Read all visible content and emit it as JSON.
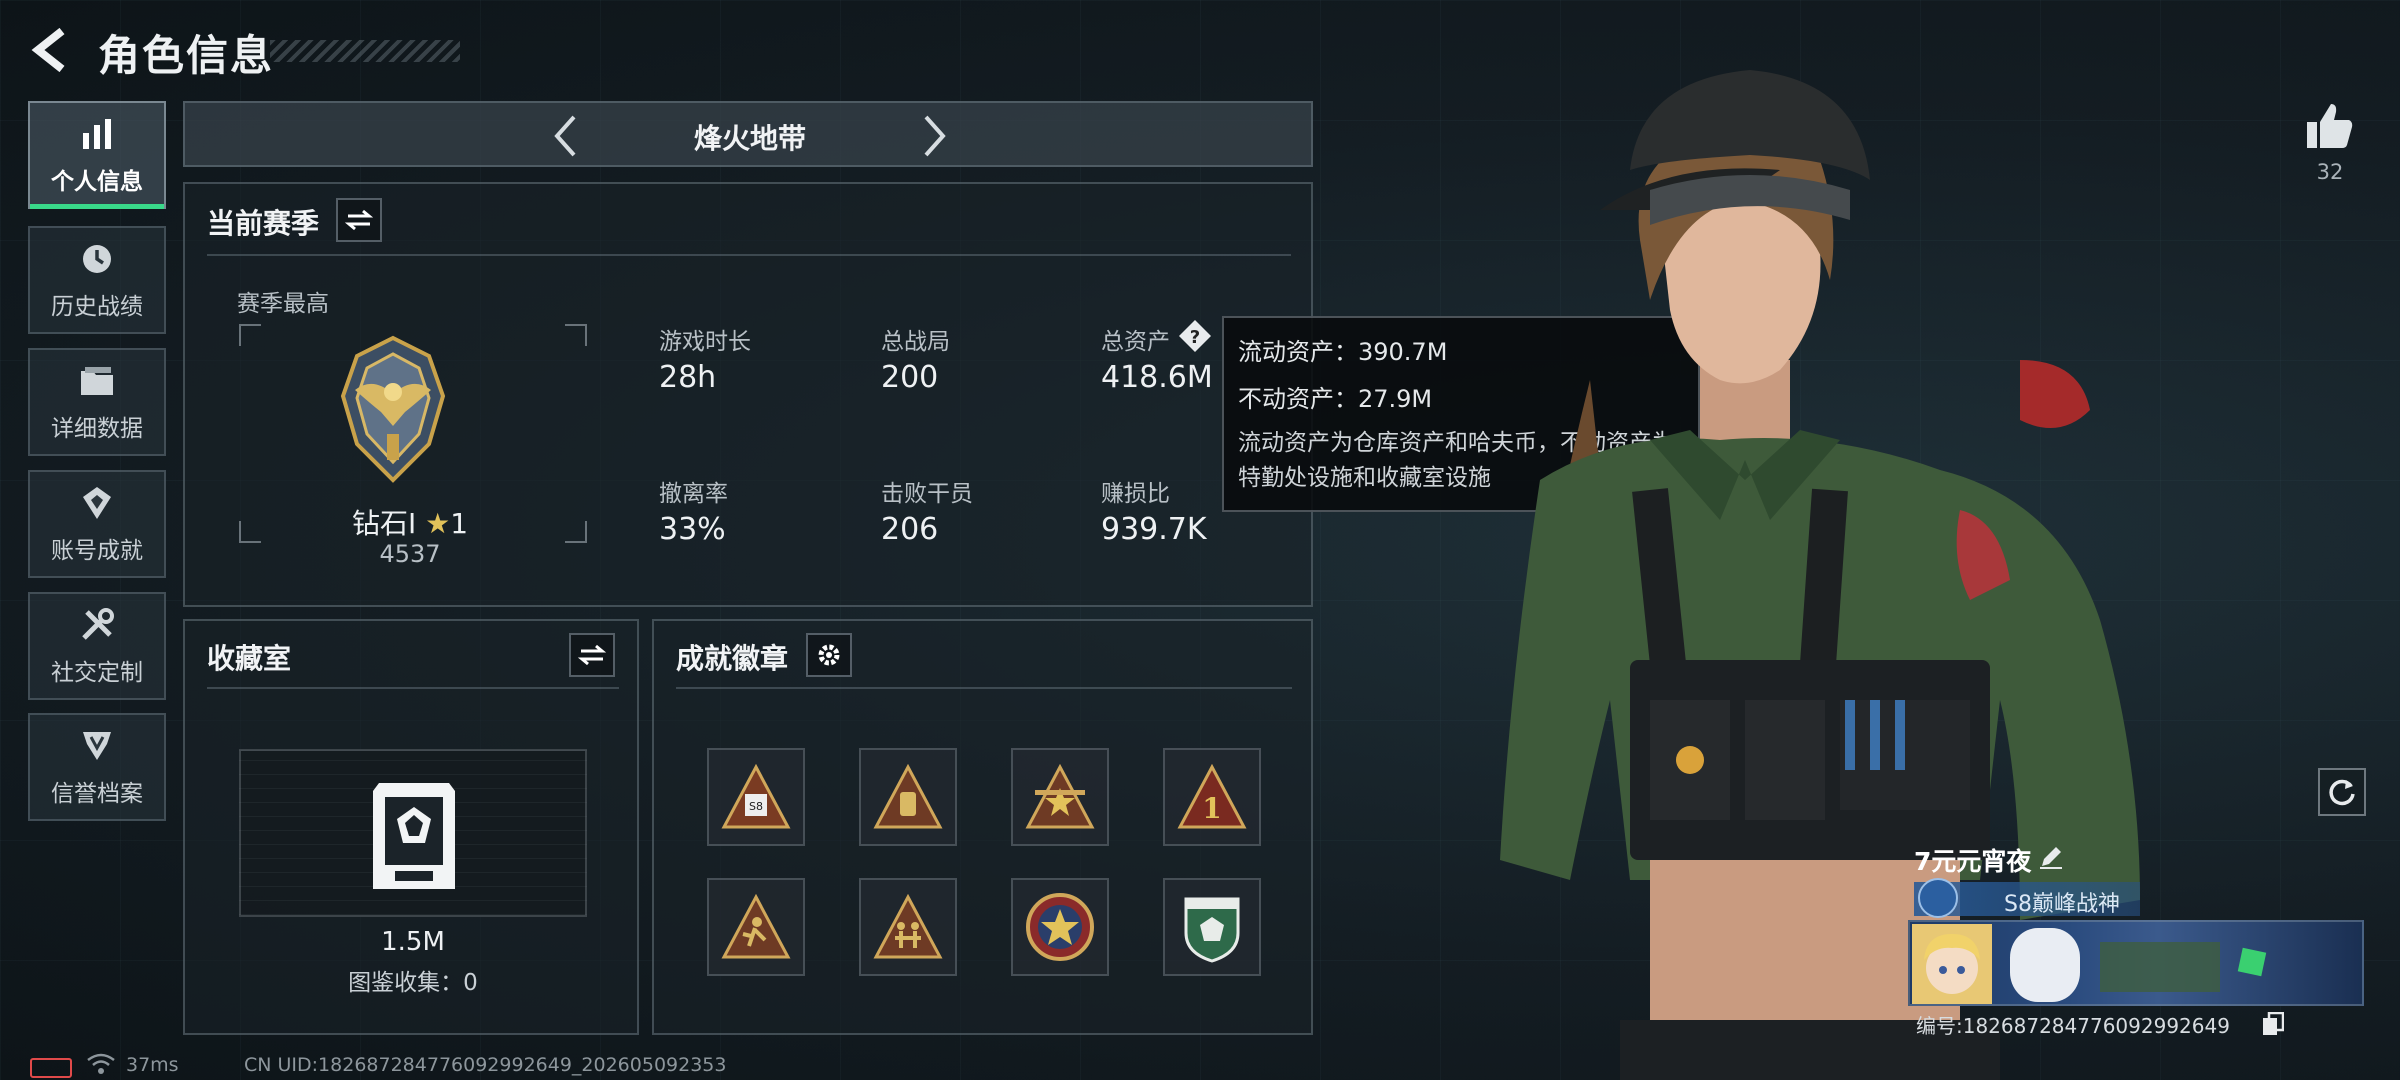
{
  "header": {
    "title": "角色信息"
  },
  "nav": {
    "items": [
      {
        "label": "个人信息",
        "icon": "bar-chart-icon",
        "active": true
      },
      {
        "label": "历史战绩",
        "icon": "history-icon",
        "active": false
      },
      {
        "label": "详细数据",
        "icon": "folder-icon",
        "active": false
      },
      {
        "label": "账号成就",
        "icon": "achievement-icon",
        "active": false
      },
      {
        "label": "社交定制",
        "icon": "tools-icon",
        "active": false
      },
      {
        "label": "信誉档案",
        "icon": "reputation-icon",
        "active": false
      }
    ]
  },
  "mode": {
    "title": "烽火地带"
  },
  "season": {
    "section_title": "当前赛季",
    "best_label": "赛季最高",
    "rank_name": "钻石I",
    "rank_stars": "1",
    "rank_score": "4537",
    "stats": [
      {
        "label": "游戏时长",
        "value": "28h"
      },
      {
        "label": "总战局",
        "value": "200"
      },
      {
        "label": "总资产",
        "value": "418.6M"
      },
      {
        "label": "撤离率",
        "value": "33%"
      },
      {
        "label": "击败干员",
        "value": "206"
      },
      {
        "label": "赚损比",
        "value": "939.7K"
      }
    ]
  },
  "tooltip": {
    "liquid": "流动资产：390.7M",
    "fixed": "不动资产：27.9M",
    "desc": "流动资产为仓库资产和哈夫币，不动资产为特勤处设施和收藏室设施"
  },
  "collection": {
    "title": "收藏室",
    "value": "1.5M",
    "catalog": "图鉴收集：0"
  },
  "achievements": {
    "title": "成就徽章",
    "badges": [
      "s8-badge-icon",
      "item-badge-icon",
      "star-badge-icon",
      "number-one-badge-icon",
      "runner-badge-icon",
      "team-badge-icon",
      "star-medal-icon",
      "gem-shield-icon"
    ]
  },
  "player": {
    "likes": "32",
    "name": "7元元宵夜",
    "rank_title": "S8巅峰战神",
    "id": "编号:1826872847760929926​49"
  },
  "status": {
    "ping": "37ms",
    "uid": "CN UID:1826872847760929926​49_202605092353"
  },
  "colors": {
    "accent": "#39d98a",
    "gold": "#c9a24a",
    "panel_border": "#78878f"
  }
}
